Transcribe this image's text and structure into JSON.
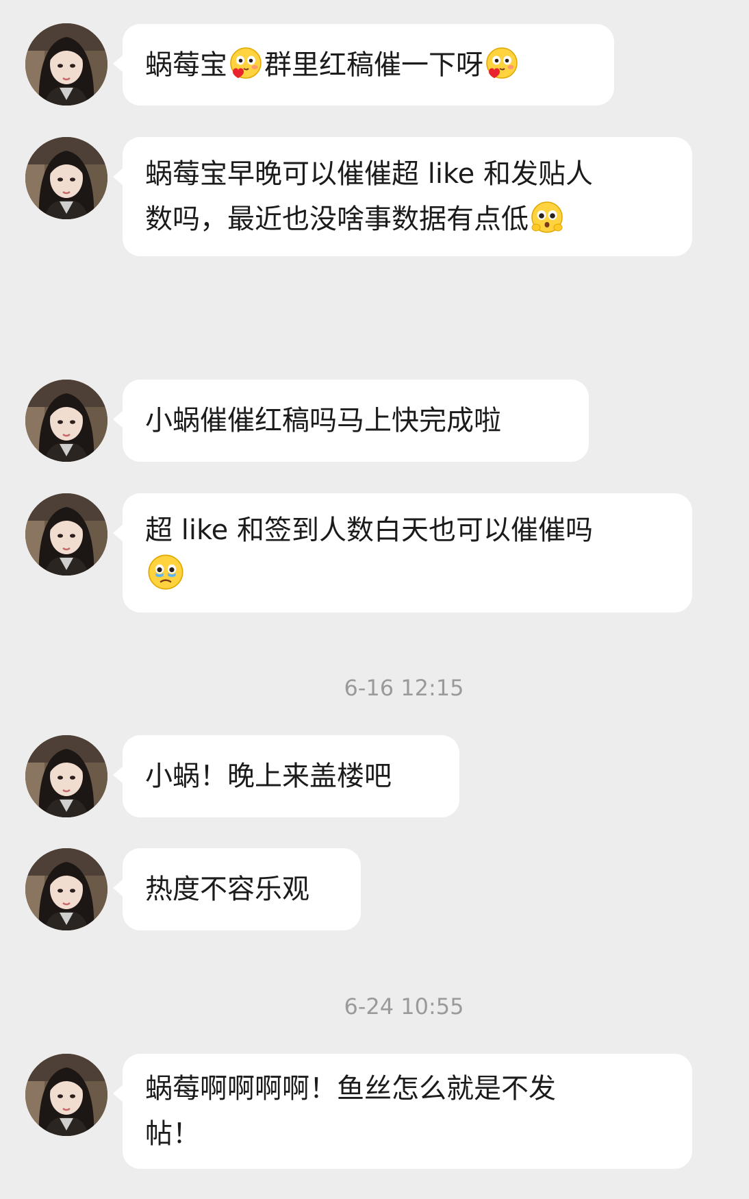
{
  "colors": {
    "background": "#ededed",
    "bubble": "#ffffff",
    "text": "#1b1b1b",
    "timestamp": "#9a9a9a"
  },
  "messages": [
    {
      "parts": [
        "蜗莓宝",
        "群里红稿催一下呀"
      ],
      "emoji": [
        "shy-heart-face"
      ]
    },
    {
      "line1": "蜗莓宝早晚可以催催超 like 和发贴人",
      "line2": "数吗，最近也没啥事数据有点低",
      "emoji": [
        "pleading-face"
      ]
    },
    {
      "text": "小蜗催催红稿吗马上快完成啦"
    },
    {
      "line1": "超 like 和签到人数白天也可以催催吗",
      "emoji": [
        "teary-sad-face"
      ]
    },
    {
      "text": "小蜗！晚上来盖楼吧"
    },
    {
      "text": "热度不容乐观"
    },
    {
      "line1": "蜗莓啊啊啊啊！鱼丝怎么就是不发",
      "line2": "帖！"
    }
  ],
  "timestamps": [
    "6-16 12:15",
    "6-24 10:55"
  ]
}
